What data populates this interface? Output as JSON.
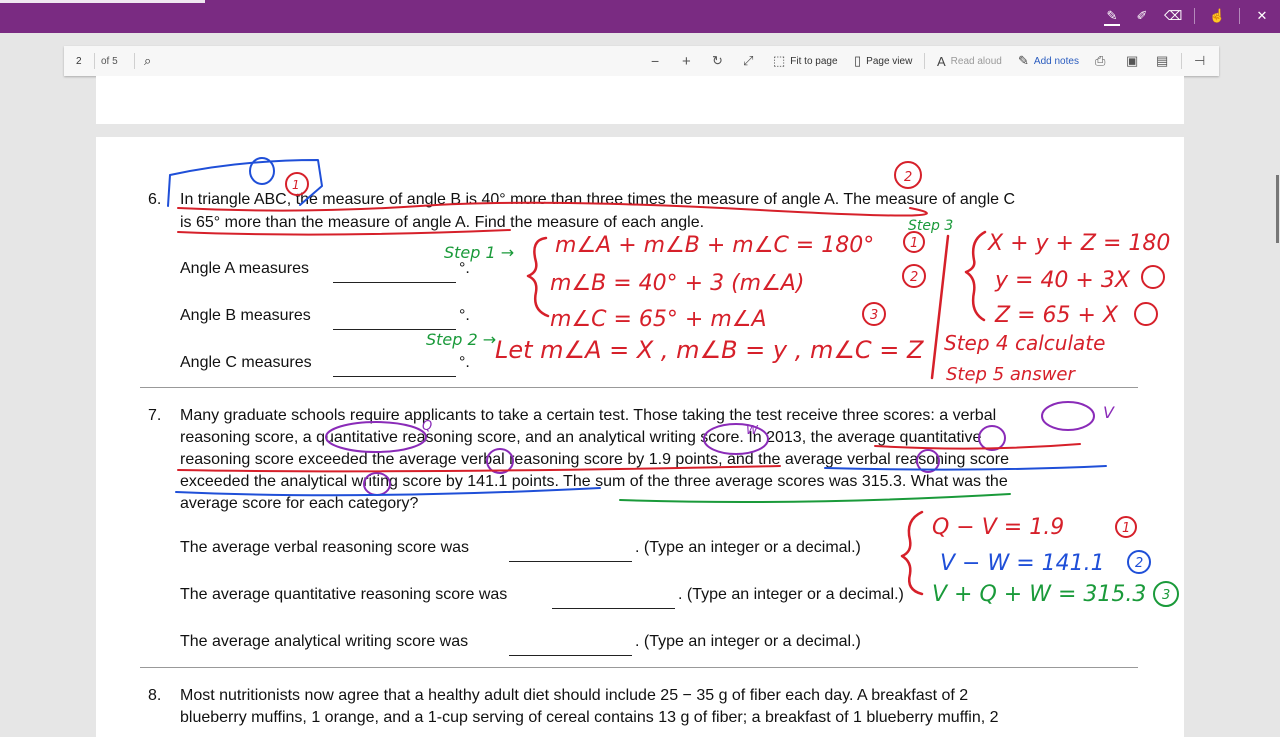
{
  "toolbar": {
    "page_number": "2",
    "page_of": "of 5",
    "fit_to_page": "Fit to page",
    "page_view": "Page view",
    "read_aloud": "Read aloud",
    "add_notes": "Add notes"
  },
  "problem6": {
    "number": "6.",
    "line1": "In triangle ABC, the measure of angle B is 40° more than three times the measure of angle A. The measure of angle C",
    "line2": "is 65° more than the measure of angle A. Find the measure of each angle.",
    "angle_a": "Angle A measures",
    "angle_b": "Angle B measures",
    "angle_c": "Angle C measures",
    "degree": "°."
  },
  "problem7": {
    "number": "7.",
    "lines": [
      "Many graduate schools require applicants to take a certain test. Those taking the test receive three scores: a verbal",
      "reasoning score, a quantitative reasoning score, and an analytical writing score. In 2013, the average quantitative",
      "reasoning score exceeded the average verbal reasoning score by 1.9 points, and the average verbal reasoning score",
      "exceeded the analytical writing score by 141.1 points. The sum of the three average scores was 315.3. What was the",
      "average score for each category?"
    ],
    "verbal": "The average verbal reasoning score was",
    "quantitative": "The average quantitative reasoning score was",
    "writing": "The average analytical writing score was",
    "hint": ". (Type an integer or a decimal.)",
    "hint_q": ". (Type an integer or a decimal.)"
  },
  "problem8": {
    "number": "8.",
    "line1": "Most nutritionists now agree that a healthy adult diet should include 25 − 35 g of fiber each day. A breakfast of 2",
    "line2": "blueberry muffins, 1 orange, and a 1-cup serving of cereal contains 13 g of fiber; a breakfast of 1 blueberry muffin, 2"
  },
  "notes": {
    "eq1": "m∠A + m∠B + m∠C = 180°",
    "eq2": "m∠B = 40° + 3 (m∠A)",
    "eq3": "m∠C = 65° + m∠A",
    "let": "Let m∠A = X , m∠B = y , m∠C = Z",
    "step1": "Step 1 →",
    "step2": "Step 2 →",
    "step3": "Step 3",
    "rhs1": "X + y + Z = 180",
    "rhs2": "y = 40 + 3X",
    "rhs3": "Z = 65 + X",
    "step4": "Step 4 calculate",
    "step5": "Step 5  answer",
    "p7eq1": "Q − V = 1.9",
    "p7eq2": "V − W = 141.1",
    "p7eq3": "V + Q + W = 315.3",
    "n1": "1",
    "n2": "2",
    "n3": "3",
    "q": "Q",
    "w": "W",
    "v": "V"
  },
  "colors": {
    "titlebar": "#7a2b82",
    "red_ink": "#d6202a",
    "green_ink": "#1a9a3a",
    "blue_ink": "#1f4fd8",
    "purple_ink": "#8a2bb8"
  }
}
